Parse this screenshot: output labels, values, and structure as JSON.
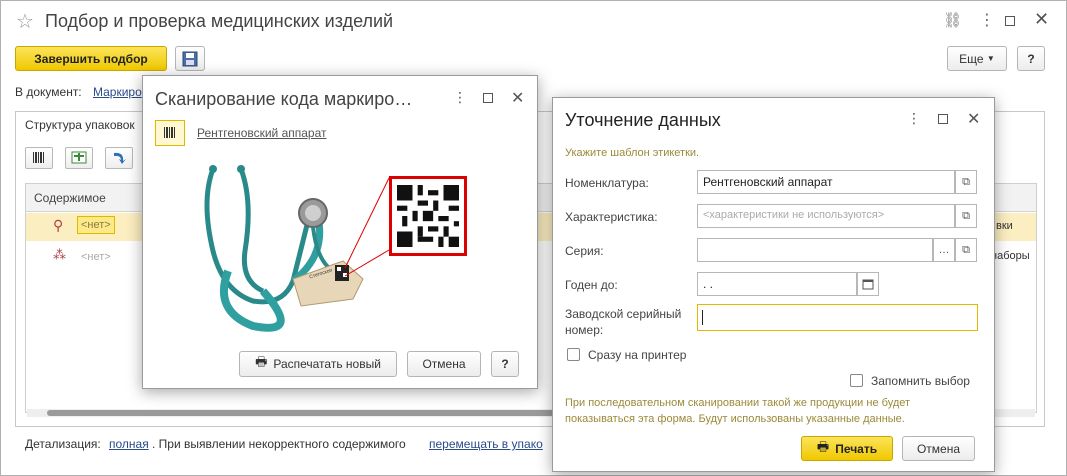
{
  "main_window": {
    "title": "Подбор и проверка медицинских изделий",
    "finish_button": "Завершить подбор",
    "more_button": "Еще",
    "help_button": "?",
    "doc_label": "В документ:",
    "doc_link": "Маркиро",
    "structure_tab": "Структура упаковок",
    "column_content": "Содержимое",
    "row1_value": "<нет>",
    "row2_value": "<нет>",
    "right_col_row1": "вки",
    "right_col_row2": "наборы",
    "detail_label": "Детализация:",
    "detail_link": "полная",
    "detail_text": ". При выявлении некорректного содержимого",
    "detail_link2": "перемещать в упако"
  },
  "scan_dialog": {
    "title": "Сканирование кода маркиро…",
    "product_link": "Рентгеновский аппарат",
    "print_new_button": "Распечатать новый",
    "cancel_button": "Отмена",
    "help_button": "?",
    "tag_text": "Стетоскоп"
  },
  "clarify_dialog": {
    "title": "Уточнение данных",
    "hint": "Укажите шаблон этикетки.",
    "nomenclature_label": "Номенклатура:",
    "nomenclature_value": "Рентгеновский аппарат",
    "characteristic_label": "Характеристика:",
    "characteristic_placeholder": "<характеристики не используются>",
    "series_label": "Серия:",
    "series_value": "",
    "expiry_label": "Годен до:",
    "expiry_value": " .  .",
    "serial_label_line1": "Заводской серийный",
    "serial_label_line2": "номер:",
    "serial_value": "",
    "to_printer_label": "Сразу на принтер",
    "remember_label": "Запомнить выбор",
    "info_text": "При последовательном сканировании такой же продукции не будет показываться эта форма. Будут использованы указанные данные.",
    "print_button": "Печать",
    "cancel_button": "Отмена",
    "more_glyph": "…"
  },
  "colors": {
    "accent_yellow": "#f5d000",
    "link": "#2a4a8a",
    "hint_text": "#9a8a3a"
  }
}
